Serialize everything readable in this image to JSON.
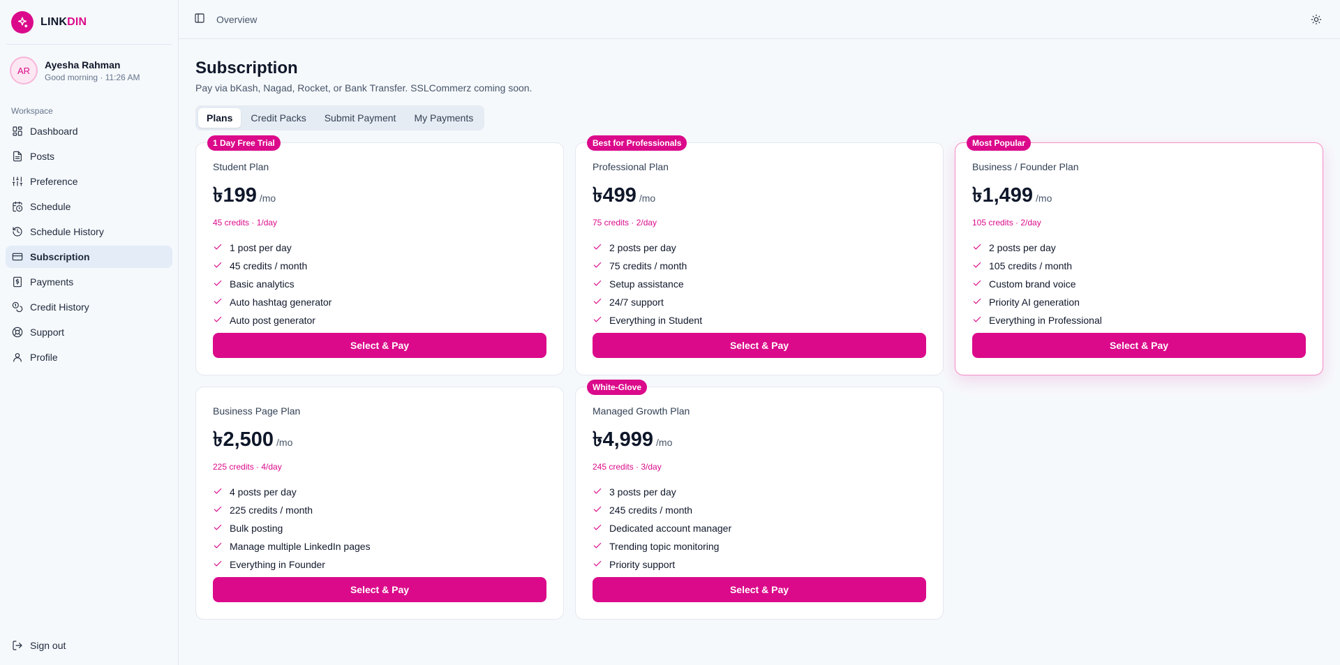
{
  "brand": {
    "name_part1": "LINK",
    "name_part2": "DIN"
  },
  "user": {
    "initials": "AR",
    "name": "Ayesha Rahman",
    "greeting": "Good morning · 11:26 AM"
  },
  "sidebar": {
    "section_label": "Workspace",
    "items": [
      {
        "label": "Dashboard",
        "icon": "dashboard-icon"
      },
      {
        "label": "Posts",
        "icon": "file-text-icon"
      },
      {
        "label": "Preference",
        "icon": "sliders-icon"
      },
      {
        "label": "Schedule",
        "icon": "calendar-clock-icon"
      },
      {
        "label": "Schedule History",
        "icon": "history-icon"
      },
      {
        "label": "Subscription",
        "icon": "credit-card-icon"
      },
      {
        "label": "Payments",
        "icon": "receipt-icon"
      },
      {
        "label": "Credit History",
        "icon": "coins-icon"
      },
      {
        "label": "Support",
        "icon": "life-buoy-icon"
      },
      {
        "label": "Profile",
        "icon": "user-icon"
      }
    ],
    "active_item": "Subscription",
    "signout_label": "Sign out"
  },
  "topbar": {
    "breadcrumb": "Overview"
  },
  "page": {
    "title": "Subscription",
    "subtitle": "Pay via bKash, Nagad, Rocket, or Bank Transfer. SSLCommerz coming soon."
  },
  "tabs": [
    {
      "label": "Plans",
      "active": true
    },
    {
      "label": "Credit Packs",
      "active": false
    },
    {
      "label": "Submit Payment",
      "active": false
    },
    {
      "label": "My Payments",
      "active": false
    }
  ],
  "plans": [
    {
      "badge": "1 Day Free Trial",
      "name": "Student Plan",
      "price": "৳199",
      "per": "/mo",
      "credits": "45 credits · 1/day",
      "features": [
        "1 post per day",
        "45 credits / month",
        "Basic analytics",
        "Auto hashtag generator",
        "Auto post generator"
      ],
      "button": "Select & Pay"
    },
    {
      "badge": "Best for Professionals",
      "name": "Professional Plan",
      "price": "৳499",
      "per": "/mo",
      "credits": "75 credits · 2/day",
      "features": [
        "2 posts per day",
        "75 credits / month",
        "Setup assistance",
        "24/7 support",
        "Everything in Student"
      ],
      "button": "Select & Pay"
    },
    {
      "badge": "Most Popular",
      "name": "Business / Founder Plan",
      "price": "৳1,499",
      "per": "/mo",
      "credits": "105 credits · 2/day",
      "features": [
        "2 posts per day",
        "105 credits / month",
        "Custom brand voice",
        "Priority AI generation",
        "Everything in Professional"
      ],
      "button": "Select & Pay"
    },
    {
      "badge": "",
      "name": "Business Page Plan",
      "price": "৳2,500",
      "per": "/mo",
      "credits": "225 credits · 4/day",
      "features": [
        "4 posts per day",
        "225 credits / month",
        "Bulk posting",
        "Manage multiple LinkedIn pages",
        "Everything in Founder"
      ],
      "button": "Select & Pay"
    },
    {
      "badge": "White-Glove",
      "name": "Managed Growth Plan",
      "price": "৳4,999",
      "per": "/mo",
      "credits": "245 credits · 3/day",
      "features": [
        "3 posts per day",
        "245 credits / month",
        "Dedicated account manager",
        "Trending topic monitoring",
        "Priority support"
      ],
      "button": "Select & Pay"
    }
  ],
  "colors": {
    "accent": "#db0a8a",
    "active_nav_bg": "#e3ecf7",
    "background": "#f6f9fc"
  }
}
